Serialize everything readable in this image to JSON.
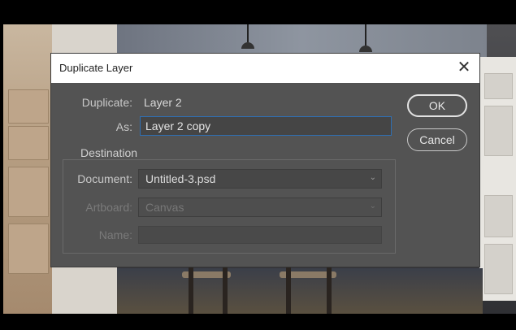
{
  "dialog": {
    "title": "Duplicate Layer",
    "close_icon": "close-icon",
    "duplicate_label": "Duplicate:",
    "duplicate_value": "Layer 2",
    "as_label": "As:",
    "as_value": "Layer 2 copy",
    "destination_title": "Destination",
    "document_label": "Document:",
    "document_value": "Untitled-3.psd",
    "artboard_label": "Artboard:",
    "artboard_value": "Canvas",
    "name_label": "Name:",
    "name_value": "",
    "ok_label": "OK",
    "cancel_label": "Cancel"
  },
  "icons": {
    "dropdown": "chevron-down-icon"
  },
  "colors": {
    "dialog_bg": "#535353",
    "focus_border": "#2f6fb3"
  }
}
